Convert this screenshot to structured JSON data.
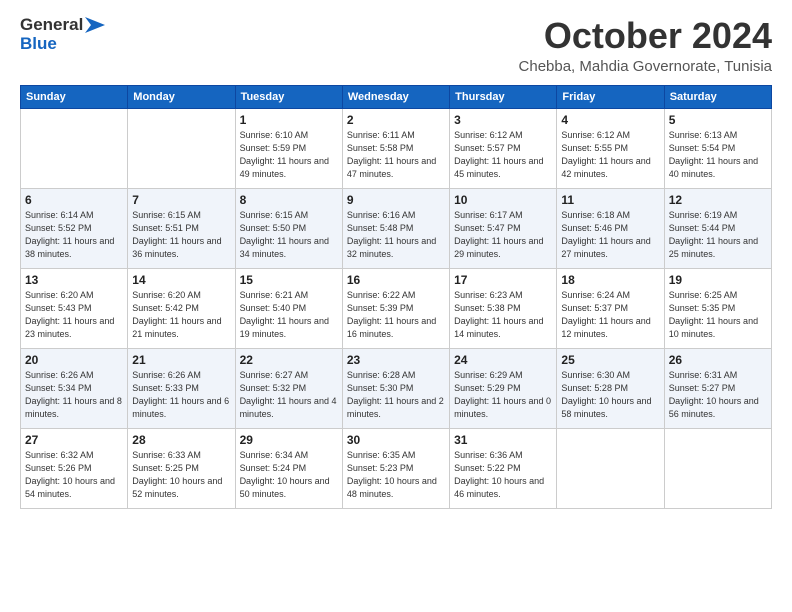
{
  "header": {
    "logo_line1": "General",
    "logo_line2": "Blue",
    "month": "October 2024",
    "location": "Chebba, Mahdia Governorate, Tunisia"
  },
  "weekdays": [
    "Sunday",
    "Monday",
    "Tuesday",
    "Wednesday",
    "Thursday",
    "Friday",
    "Saturday"
  ],
  "weeks": [
    [
      null,
      null,
      {
        "day": 1,
        "sunrise": "6:10 AM",
        "sunset": "5:59 PM",
        "daylight": "11 hours and 49 minutes."
      },
      {
        "day": 2,
        "sunrise": "6:11 AM",
        "sunset": "5:58 PM",
        "daylight": "11 hours and 47 minutes."
      },
      {
        "day": 3,
        "sunrise": "6:12 AM",
        "sunset": "5:57 PM",
        "daylight": "11 hours and 45 minutes."
      },
      {
        "day": 4,
        "sunrise": "6:12 AM",
        "sunset": "5:55 PM",
        "daylight": "11 hours and 42 minutes."
      },
      {
        "day": 5,
        "sunrise": "6:13 AM",
        "sunset": "5:54 PM",
        "daylight": "11 hours and 40 minutes."
      }
    ],
    [
      {
        "day": 6,
        "sunrise": "6:14 AM",
        "sunset": "5:52 PM",
        "daylight": "11 hours and 38 minutes."
      },
      {
        "day": 7,
        "sunrise": "6:15 AM",
        "sunset": "5:51 PM",
        "daylight": "11 hours and 36 minutes."
      },
      {
        "day": 8,
        "sunrise": "6:15 AM",
        "sunset": "5:50 PM",
        "daylight": "11 hours and 34 minutes."
      },
      {
        "day": 9,
        "sunrise": "6:16 AM",
        "sunset": "5:48 PM",
        "daylight": "11 hours and 32 minutes."
      },
      {
        "day": 10,
        "sunrise": "6:17 AM",
        "sunset": "5:47 PM",
        "daylight": "11 hours and 29 minutes."
      },
      {
        "day": 11,
        "sunrise": "6:18 AM",
        "sunset": "5:46 PM",
        "daylight": "11 hours and 27 minutes."
      },
      {
        "day": 12,
        "sunrise": "6:19 AM",
        "sunset": "5:44 PM",
        "daylight": "11 hours and 25 minutes."
      }
    ],
    [
      {
        "day": 13,
        "sunrise": "6:20 AM",
        "sunset": "5:43 PM",
        "daylight": "11 hours and 23 minutes."
      },
      {
        "day": 14,
        "sunrise": "6:20 AM",
        "sunset": "5:42 PM",
        "daylight": "11 hours and 21 minutes."
      },
      {
        "day": 15,
        "sunrise": "6:21 AM",
        "sunset": "5:40 PM",
        "daylight": "11 hours and 19 minutes."
      },
      {
        "day": 16,
        "sunrise": "6:22 AM",
        "sunset": "5:39 PM",
        "daylight": "11 hours and 16 minutes."
      },
      {
        "day": 17,
        "sunrise": "6:23 AM",
        "sunset": "5:38 PM",
        "daylight": "11 hours and 14 minutes."
      },
      {
        "day": 18,
        "sunrise": "6:24 AM",
        "sunset": "5:37 PM",
        "daylight": "11 hours and 12 minutes."
      },
      {
        "day": 19,
        "sunrise": "6:25 AM",
        "sunset": "5:35 PM",
        "daylight": "11 hours and 10 minutes."
      }
    ],
    [
      {
        "day": 20,
        "sunrise": "6:26 AM",
        "sunset": "5:34 PM",
        "daylight": "11 hours and 8 minutes."
      },
      {
        "day": 21,
        "sunrise": "6:26 AM",
        "sunset": "5:33 PM",
        "daylight": "11 hours and 6 minutes."
      },
      {
        "day": 22,
        "sunrise": "6:27 AM",
        "sunset": "5:32 PM",
        "daylight": "11 hours and 4 minutes."
      },
      {
        "day": 23,
        "sunrise": "6:28 AM",
        "sunset": "5:30 PM",
        "daylight": "11 hours and 2 minutes."
      },
      {
        "day": 24,
        "sunrise": "6:29 AM",
        "sunset": "5:29 PM",
        "daylight": "11 hours and 0 minutes."
      },
      {
        "day": 25,
        "sunrise": "6:30 AM",
        "sunset": "5:28 PM",
        "daylight": "10 hours and 58 minutes."
      },
      {
        "day": 26,
        "sunrise": "6:31 AM",
        "sunset": "5:27 PM",
        "daylight": "10 hours and 56 minutes."
      }
    ],
    [
      {
        "day": 27,
        "sunrise": "6:32 AM",
        "sunset": "5:26 PM",
        "daylight": "10 hours and 54 minutes."
      },
      {
        "day": 28,
        "sunrise": "6:33 AM",
        "sunset": "5:25 PM",
        "daylight": "10 hours and 52 minutes."
      },
      {
        "day": 29,
        "sunrise": "6:34 AM",
        "sunset": "5:24 PM",
        "daylight": "10 hours and 50 minutes."
      },
      {
        "day": 30,
        "sunrise": "6:35 AM",
        "sunset": "5:23 PM",
        "daylight": "10 hours and 48 minutes."
      },
      {
        "day": 31,
        "sunrise": "6:36 AM",
        "sunset": "5:22 PM",
        "daylight": "10 hours and 46 minutes."
      },
      null,
      null
    ]
  ]
}
